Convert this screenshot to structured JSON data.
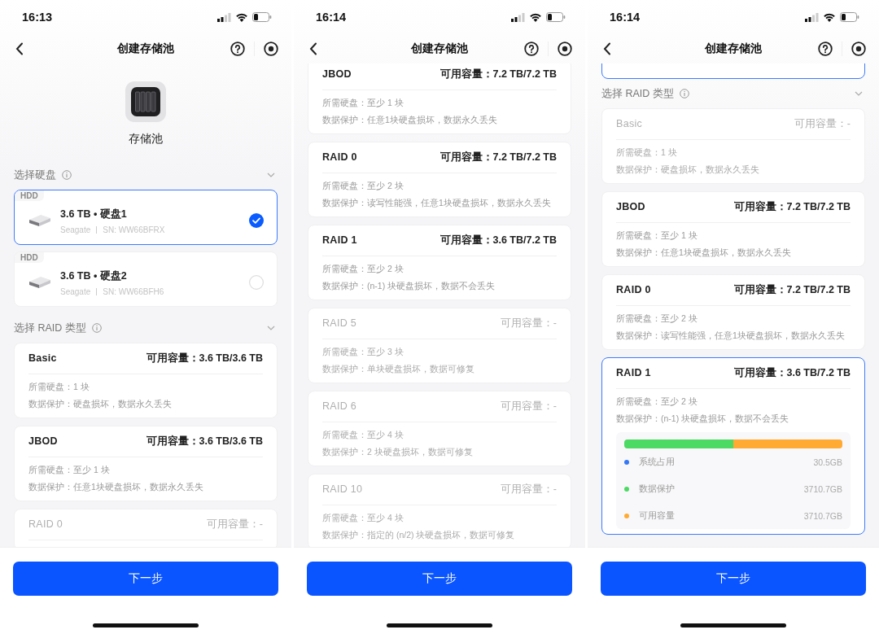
{
  "phones": [
    {
      "time": "16:13",
      "title": "创建存储池",
      "button": "下一步",
      "blocks": [
        {
          "kind": "pool",
          "label": "存储池"
        },
        {
          "kind": "heading",
          "text": "选择硬盘"
        },
        {
          "kind": "disk",
          "tag": "HDD",
          "name": "3.6 TB • 硬盘1",
          "vendor": "Seagate",
          "serial": "SN: WW66BFRX",
          "selected": true
        },
        {
          "kind": "disk",
          "tag": "HDD",
          "name": "3.6 TB • 硬盘2",
          "vendor": "Seagate",
          "serial": "SN: WW66BFH6",
          "selected": false
        },
        {
          "kind": "heading",
          "text": "选择 RAID 类型"
        },
        {
          "kind": "raid",
          "name": "Basic",
          "capacity": "可用容量：3.6 TB/3.6 TB",
          "required": "所需硬盘：1 块",
          "protection": "数据保护：硬盘损坏，数据永久丢失",
          "disabled": false,
          "selected": false
        },
        {
          "kind": "raid",
          "name": "JBOD",
          "capacity": "可用容量：3.6 TB/3.6 TB",
          "required": "所需硬盘：至少 1 块",
          "protection": "数据保护：任意1块硬盘损坏，数据永久丢失",
          "disabled": false,
          "selected": false
        },
        {
          "kind": "raid",
          "name": "RAID 0",
          "capacity": "可用容量：-",
          "disabled": true,
          "selected": false
        }
      ]
    },
    {
      "time": "16:14",
      "title": "创建存储池",
      "button": "下一步",
      "blocks": [
        {
          "kind": "raid",
          "name": "JBOD",
          "capacity": "可用容量：7.2 TB/7.2 TB",
          "required": "所需硬盘：至少 1 块",
          "protection": "数据保护：任意1块硬盘损坏，数据永久丢失",
          "disabled": false,
          "selected": false
        },
        {
          "kind": "raid",
          "name": "RAID 0",
          "capacity": "可用容量：7.2 TB/7.2 TB",
          "required": "所需硬盘：至少 2 块",
          "protection": "数据保护：读写性能强，任意1块硬盘损坏，数据永久丢失",
          "disabled": false,
          "selected": false
        },
        {
          "kind": "raid",
          "name": "RAID 1",
          "capacity": "可用容量：3.6 TB/7.2 TB",
          "required": "所需硬盘：至少 2 块",
          "protection": "数据保护：(n-1) 块硬盘损坏，数据不会丢失",
          "disabled": false,
          "selected": false
        },
        {
          "kind": "raid",
          "name": "RAID 5",
          "capacity": "可用容量：-",
          "required": "所需硬盘：至少 3 块",
          "protection": "数据保护：单块硬盘损坏，数据可修复",
          "disabled": true,
          "selected": false
        },
        {
          "kind": "raid",
          "name": "RAID 6",
          "capacity": "可用容量：-",
          "required": "所需硬盘：至少 4 块",
          "protection": "数据保护：2 块硬盘损坏，数据可修复",
          "disabled": true,
          "selected": false
        },
        {
          "kind": "raid",
          "name": "RAID 10",
          "capacity": "可用容量：-",
          "required": "所需硬盘：至少 4 块",
          "protection": "数据保护：指定的 (n/2) 块硬盘损坏，数据可修复",
          "disabled": true,
          "selected": false
        }
      ]
    },
    {
      "time": "16:14",
      "title": "创建存储池",
      "button": "下一步",
      "blocks": [
        {
          "kind": "disk-edge",
          "selected": true
        },
        {
          "kind": "heading",
          "text": "选择 RAID 类型"
        },
        {
          "kind": "raid",
          "name": "Basic",
          "capacity": "可用容量：-",
          "required": "所需硬盘：1 块",
          "protection": "数据保护：硬盘损坏，数据永久丢失",
          "disabled": true,
          "selected": false
        },
        {
          "kind": "raid",
          "name": "JBOD",
          "capacity": "可用容量：7.2 TB/7.2 TB",
          "required": "所需硬盘：至少 1 块",
          "protection": "数据保护：任意1块硬盘损坏，数据永久丢失",
          "disabled": false,
          "selected": false
        },
        {
          "kind": "raid",
          "name": "RAID 0",
          "capacity": "可用容量：7.2 TB/7.2 TB",
          "required": "所需硬盘：至少 2 块",
          "protection": "数据保护：读写性能强，任意1块硬盘损坏，数据永久丢失",
          "disabled": false,
          "selected": false
        },
        {
          "kind": "raid",
          "name": "RAID 1",
          "capacity": "可用容量：3.6 TB/7.2 TB",
          "required": "所需硬盘：至少 2 块",
          "protection": "数据保护：(n-1) 块硬盘损坏，数据不会丢失",
          "disabled": false,
          "selected": true,
          "usage": {
            "bar": [
              {
                "color": "#4cd964",
                "level": 0.5
              },
              {
                "color": "#ffaa33",
                "level": 0.5
              }
            ],
            "legend": [
              {
                "label": "系统占用",
                "value": "30.5GB",
                "color": "#3478f6"
              },
              {
                "label": "数据保护",
                "value": "3710.7GB",
                "color": "#4cd964"
              },
              {
                "label": "可用容量",
                "value": "3710.7GB",
                "color": "#ffaa33"
              }
            ]
          }
        }
      ]
    }
  ]
}
